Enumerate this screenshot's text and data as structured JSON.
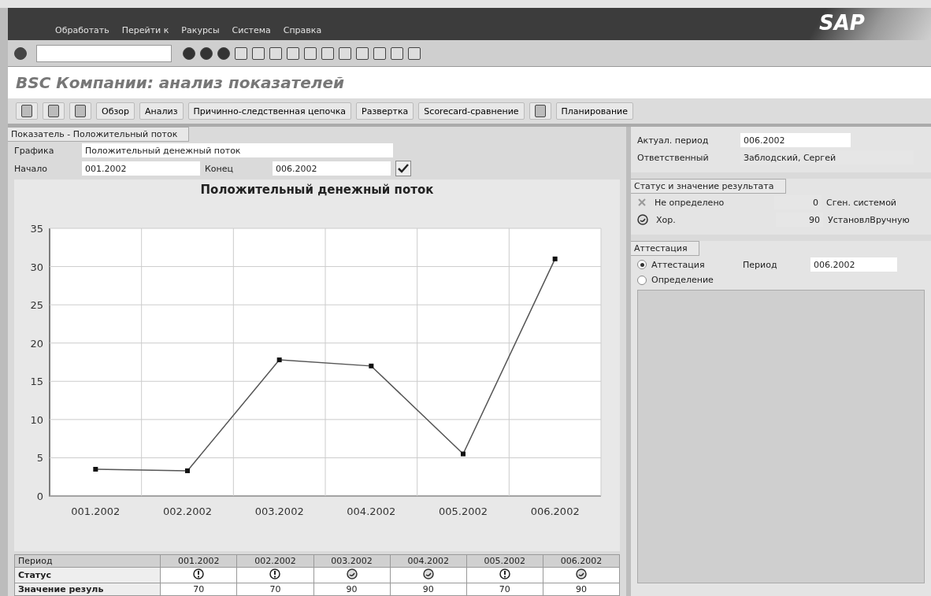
{
  "menu": [
    "Обработать",
    "Перейти к",
    "Ракурсы",
    "Система",
    "Справка"
  ],
  "logo": "SAP",
  "title": "BSC Компании: анализ показателей",
  "app_toolbar": [
    {
      "kind": "icon"
    },
    {
      "kind": "icon"
    },
    {
      "kind": "icon"
    },
    {
      "kind": "text",
      "label": "Обзор"
    },
    {
      "kind": "text",
      "label": "Анализ"
    },
    {
      "kind": "text",
      "label": "Причинно-следственная цепочка"
    },
    {
      "kind": "text",
      "label": "Развертка"
    },
    {
      "kind": "text",
      "label": "Scorecard-сравнение"
    },
    {
      "kind": "icon"
    },
    {
      "kind": "text",
      "label": "Планирование"
    }
  ],
  "indicator": {
    "tab": "Показатель - Положительный поток",
    "graphic_label": "Графика",
    "graphic_value": "Положительный денежный поток",
    "start_label": "Начало",
    "start_value": "001.2002",
    "end_label": "Конец",
    "end_value": "006.2002",
    "chart_data": {
      "type": "line",
      "title": "Положительный денежный поток",
      "categories": [
        "001.2002",
        "002.2002",
        "003.2002",
        "004.2002",
        "005.2002",
        "006.2002"
      ],
      "series": [
        {
          "color": "#555555",
          "marker": "square",
          "values": [
            3.5,
            3.3,
            17.8,
            17,
            5.5,
            31
          ]
        }
      ],
      "grid": true,
      "ylim": [
        0,
        35
      ],
      "yticks": [
        0,
        5,
        10,
        15,
        20,
        25,
        30,
        35
      ]
    },
    "table": {
      "header": [
        "Период",
        "001.2002",
        "002.2002",
        "003.2002",
        "004.2002",
        "005.2002",
        "006.2002"
      ],
      "status_label": "Статус",
      "status": [
        {
          "kind": "warning"
        },
        {
          "kind": "warning"
        },
        {
          "kind": "good"
        },
        {
          "kind": "good"
        },
        {
          "kind": "warning"
        },
        {
          "kind": "good"
        }
      ],
      "value_label": "Значение резуль",
      "values": [
        "70",
        "70",
        "90",
        "90",
        "70",
        "90"
      ]
    }
  },
  "right": {
    "period_label": "Актуал. период",
    "period_value": "006.2002",
    "owner_label": "Ответственный",
    "owner_value": "Заблодский, Сергей",
    "status_tab": "Статус и значение результата",
    "status_rows": [
      {
        "kind": "undefined",
        "label": "Не определено",
        "value": "0",
        "source": "Сген. системой"
      },
      {
        "kind": "good",
        "label": "Хор.",
        "value": "90",
        "source": "УстановлВручную"
      }
    ],
    "attest_tab": "Аттестация",
    "radios": [
      {
        "label": "Аттестация",
        "selected": true
      },
      {
        "label": "Определение",
        "selected": false
      }
    ],
    "attest_period_label": "Период",
    "attest_period_value": "006.2002"
  }
}
